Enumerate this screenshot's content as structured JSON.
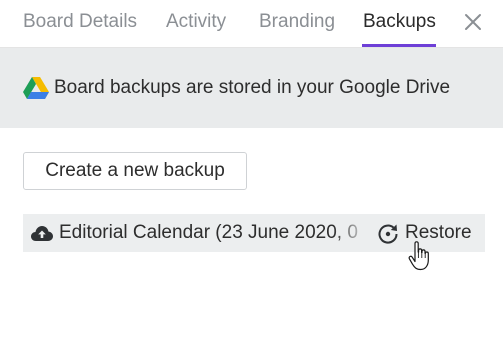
{
  "tabs": [
    {
      "label": "Board Details",
      "active": false
    },
    {
      "label": "Activity",
      "active": false
    },
    {
      "label": "Branding",
      "active": false
    },
    {
      "label": "Backups",
      "active": true
    }
  ],
  "close_icon": "close-x-icon",
  "banner": {
    "icon": "google-drive-icon",
    "text": "Board backups are stored in your Google Drive"
  },
  "create_backup": {
    "label": "Create a new backup"
  },
  "backups": [
    {
      "icon": "cloud-upload-icon",
      "name": "Editorial Calendar (23 June 2020, 0",
      "restore_label": "Restore",
      "restore_icon": "restore-icon"
    }
  ],
  "colors": {
    "accent": "#6e3fd7",
    "banner_bg": "#e9ebec",
    "row_bg": "#eceeef",
    "inactive_tab": "#8b8f94"
  }
}
